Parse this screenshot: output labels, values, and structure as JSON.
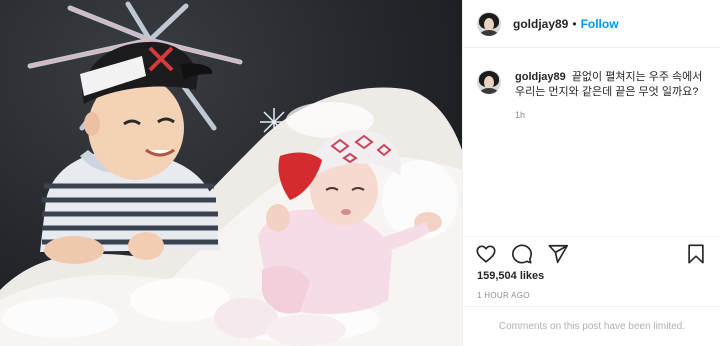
{
  "post": {
    "username": "goldjay89",
    "dot": "•",
    "follow_label": "Follow",
    "caption": {
      "username": "goldjay89",
      "text": "끝없이 펼쳐지는 우주 속에서 우리는 먼지와 같은데 끝은 무엇 일까요?",
      "time": "1h"
    },
    "likes": "159,504 likes",
    "time_ago": "1 HOUR AGO",
    "comments_notice": "Comments on this post have been limited."
  },
  "icons": {
    "like": "heart-icon",
    "comment": "comment-icon",
    "share": "paper-plane-icon",
    "save": "bookmark-icon"
  },
  "colors": {
    "accent": "#0095f6",
    "text": "#262626",
    "muted": "#8e8e8e",
    "border": "#efefef"
  }
}
